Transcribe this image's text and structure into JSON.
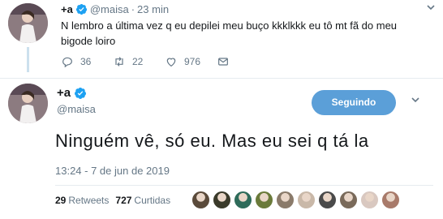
{
  "parent_tweet": {
    "name": "+a",
    "handle": "@maisa",
    "separator": "·",
    "time": "23 min",
    "text": "N lembro a última vez q eu depilei meu buço kkklkkk eu tô mt fã do meu bigode loiro",
    "actions": {
      "reply_count": "36",
      "retweet_count": "22",
      "like_count": "976"
    }
  },
  "main_tweet": {
    "name": "+a",
    "handle": "@maisa",
    "follow_button_label": "Seguindo",
    "text": "Ninguém vê, só eu. Mas eu sei q tá la",
    "timestamp": "13:24 - 7 de jun de 2019",
    "stats": {
      "retweets_count": "29",
      "retweets_label": "Retweets",
      "likes_count": "727",
      "likes_label": "Curtidas"
    }
  },
  "colors": {
    "accent": "#1da1f2",
    "button_bg": "#5b9fd8",
    "muted_text": "#657786",
    "thread_line": "#cce0ee"
  },
  "icons": [
    "verified-badge-icon",
    "reply-icon",
    "retweet-icon",
    "like-icon",
    "direct-message-icon",
    "chevron-down-icon"
  ],
  "liker_avatar_colors": [
    "#5a4a3a",
    "#3a3a2a",
    "#2e6b5a",
    "#6a7a3a",
    "#8a7a6a",
    "#c9b8a8",
    "#4a4a4a",
    "#7a6a5a",
    "#d9c8c0",
    "#a87a6a"
  ]
}
